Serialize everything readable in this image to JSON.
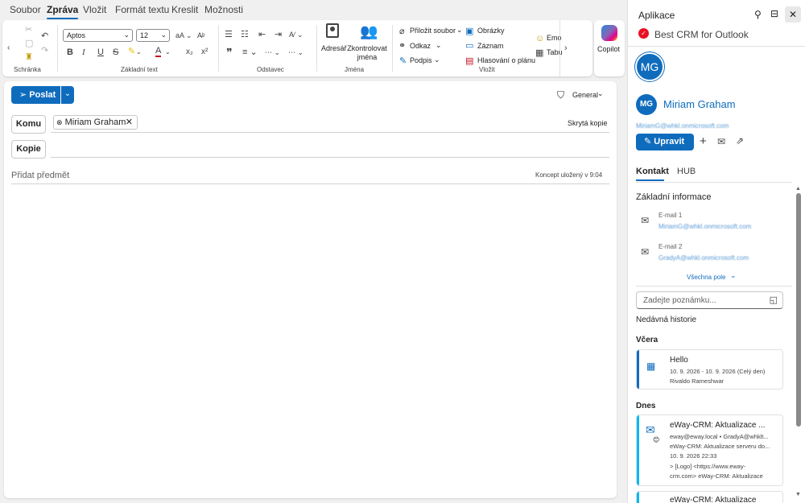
{
  "menu": {
    "tabs": [
      "Soubor",
      "Zpráva",
      "Vložit",
      "Formát textu",
      "Kreslit",
      "Možnosti"
    ],
    "active": "Zpráva"
  },
  "ribbon": {
    "clipboard_label": "Schránka",
    "basic_text_label": "Základní text",
    "font_name": "Aptos",
    "font_size": "12",
    "paragraph_label": "Odstavec",
    "names": {
      "addressbook": "Adresář",
      "check": "Zkontrolovat jména",
      "label": "Jména"
    },
    "insert": {
      "attach": "Přiložit soubor",
      "link": "Odkaz",
      "signature": "Podpis",
      "images": "Obrázky",
      "record": "Záznam",
      "voting": "Hlasování o plánu",
      "emoji": "Emo",
      "table": "Tabu",
      "label": "Vložit"
    },
    "copilot": "Copilot"
  },
  "compose": {
    "send": "Poslat",
    "sensitivity": "General",
    "to_label": "Komu",
    "recipient": "Miriam Graham",
    "bcc": "Skrytá kopie",
    "cc_label": "Kopie",
    "subject_placeholder": "Přidat předmět",
    "draft_status": "Koncept uložený v 9:04"
  },
  "panel": {
    "title": "Aplikace",
    "addin": "Best CRM for Outlook",
    "app_initials": "MG",
    "contact": {
      "initials": "MG",
      "name": "Miriam Graham",
      "email": "MiriamG@whkl.onmicrosoft.com"
    },
    "edit": "Upravit",
    "tabs": [
      "Kontakt",
      "HUB"
    ],
    "basic_info": "Základní informace",
    "email1_label": "E-mail 1",
    "email1": "MiriamG@whkl.onmicrosoft.com",
    "email2_label": "E-mail 2",
    "email2": "GradyA@whkl.onmicrosoft.com",
    "all_fields": "Všechna pole",
    "note_placeholder": "Zadejte poznámku...",
    "history": "Nedávná historie",
    "yesterday": "Včera",
    "today": "Dnes",
    "items": [
      {
        "title": "Hello",
        "line1": "10. 9. 2026 - 10. 9. 2026 (Celý den)",
        "line2": "Rivaldo Rameshwar"
      },
      {
        "title": "eWay-CRM: Aktualizace ...",
        "line1": "eway@eway.local • GradyA@whklt...",
        "line2": "eWay-CRM: Aktualizace serveru do...",
        "line3": "10. 9. 2026 22:33",
        "line4": "> [Logo] <https://www.eway-",
        "line5": "crm.com>  eWay-CRM: Aktualizace"
      },
      {
        "title": "eWay-CRM: Aktualizace"
      }
    ]
  },
  "colors": {
    "accent": "#0f6cbd",
    "ribbon_bg": "#ffffff",
    "app_bg": "#f0f0f0"
  }
}
